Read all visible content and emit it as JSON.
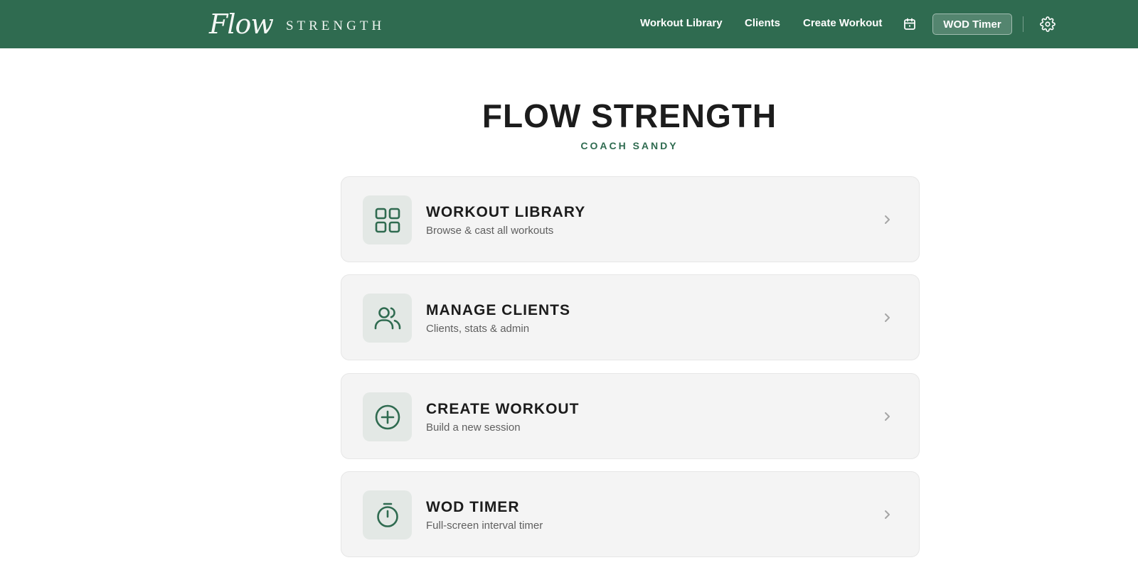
{
  "header": {
    "logo_script": "Flow",
    "logo_word": "STRENGTH",
    "nav": {
      "workout_library": "Workout Library",
      "clients": "Clients",
      "create_workout": "Create Workout",
      "calendar_icon": "calendar-icon",
      "wod_timer": "WOD Timer",
      "settings_icon": "gear-icon"
    }
  },
  "hero": {
    "title": "FLOW STRENGTH",
    "subtitle": "COACH SANDY"
  },
  "cards": [
    {
      "title": "WORKOUT LIBRARY",
      "description": "Browse & cast all workouts",
      "icon": "grid-icon"
    },
    {
      "title": "MANAGE CLIENTS",
      "description": "Clients, stats & admin",
      "icon": "users-icon"
    },
    {
      "title": "CREATE WORKOUT",
      "description": "Build a new session",
      "icon": "plus-circle-icon"
    },
    {
      "title": "WOD TIMER",
      "description": "Full-screen interval timer",
      "icon": "stopwatch-icon"
    }
  ],
  "colors": {
    "brand_green": "#2f6b50",
    "card_bg": "#f4f4f4",
    "icon_tile_bg": "#e3e8e5"
  }
}
